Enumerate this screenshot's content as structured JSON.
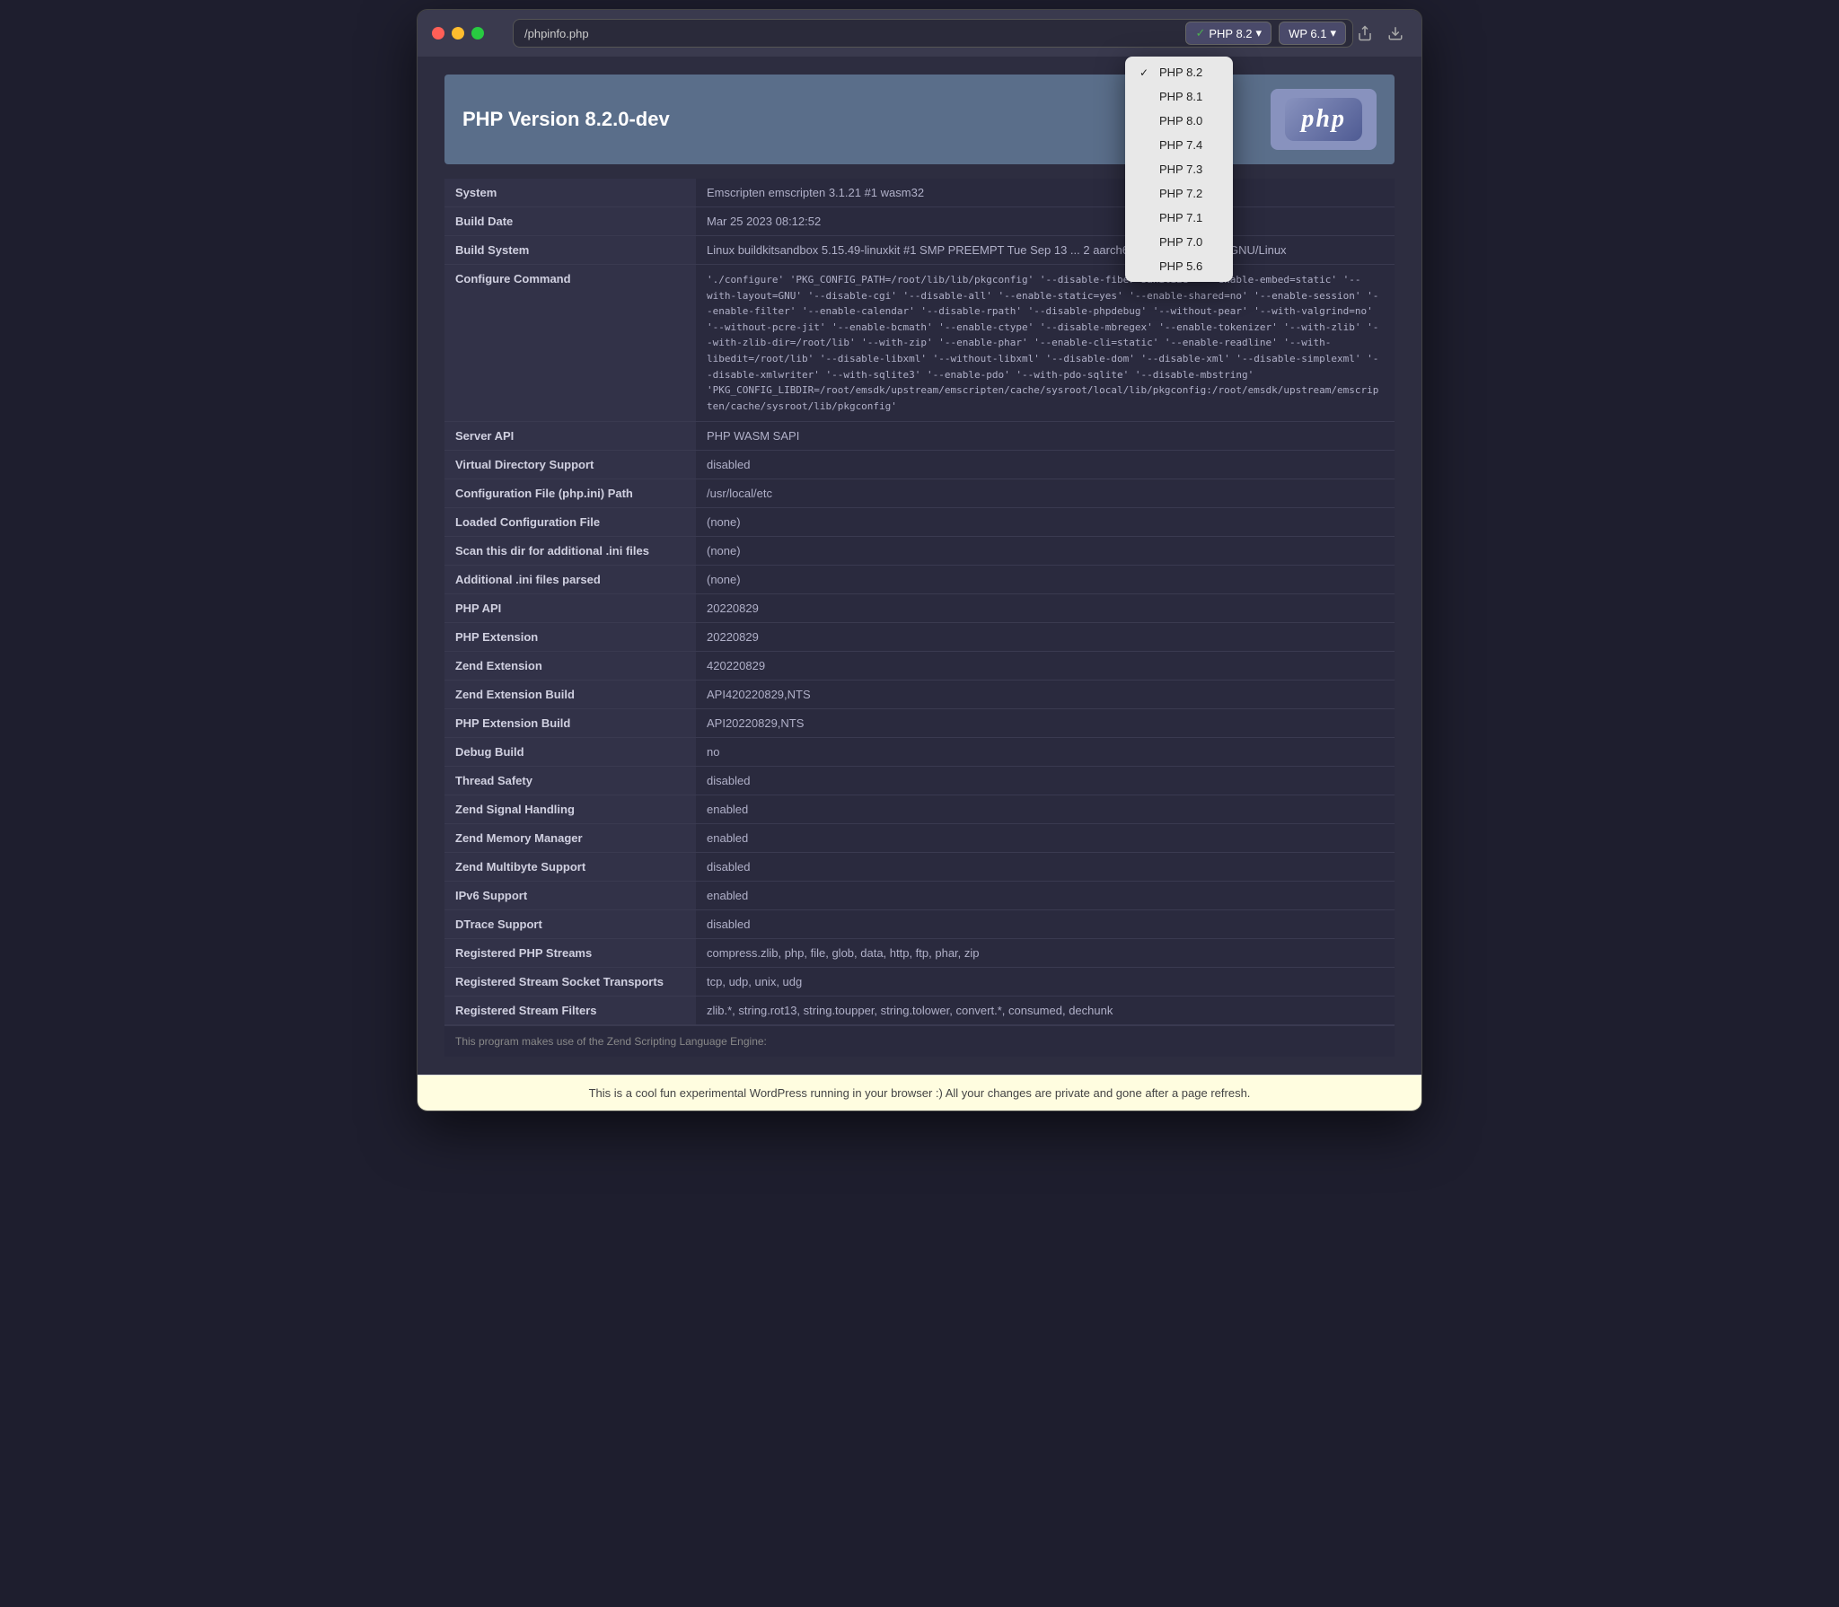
{
  "window": {
    "url": "/phpinfo.php"
  },
  "titlebar": {
    "traffic_lights": [
      "red",
      "yellow",
      "green"
    ],
    "php_version_selected": "PHP 8.2",
    "php_versions": [
      {
        "label": "PHP 8.2",
        "selected": true
      },
      {
        "label": "PHP 8.1",
        "selected": false
      },
      {
        "label": "PHP 8.0",
        "selected": false
      },
      {
        "label": "PHP 7.4",
        "selected": false
      },
      {
        "label": "PHP 7.3",
        "selected": false
      },
      {
        "label": "PHP 7.2",
        "selected": false
      },
      {
        "label": "PHP 7.1",
        "selected": false
      },
      {
        "label": "PHP 7.0",
        "selected": false
      },
      {
        "label": "PHP 5.6",
        "selected": false
      }
    ],
    "wp_version": "WP 6.1",
    "share_icon": "⬆",
    "download_icon": "⬇"
  },
  "php_info": {
    "title": "PHP Version 8.2.0-dev",
    "logo_text": "php",
    "rows": [
      {
        "label": "System",
        "value": "Emscripten emscripten 3.1.21 #1 wasm32"
      },
      {
        "label": "Build Date",
        "value": "Mar 25 2023 08:12:52"
      },
      {
        "label": "Build System",
        "value": "Linux buildkitsandbox 5.15.49-linuxkit #1 SMP PREEMPT Tue Sep 13 ... 2 aarch64 aarch64 aarch64 GNU/Linux"
      },
      {
        "label": "Configure Command",
        "value": "'./configure' 'PKG_CONFIG_PATH=/root/lib/lib/pkgconfig' '--disable-fiber-sanitize' '--enable-embed=static' '--with-layout=GNU' '--disable-cgi' '--disable-all' '--enable-static=yes' '--enable-shared=no' '--enable-session' '--enable-filter' '--enable-calendar' '--disable-rpath' '--disable-phpdebug' '--without-pear' '--with-valgrind=no' '--without-pcre-jit' '--enable-bcmath' '--enable-ctype' '--disable-mbregex' '--enable-tokenizer' '--with-zlib' '--with-zlib-dir=/root/lib' '--with-zip' '--enable-phar' '--enable-cli=static' '--enable-readline' '--with-libedit=/root/lib' '--disable-libxml' '--without-libxml' '--disable-dom' '--disable-xml' '--disable-simplexml' '--disable-xmlwriter' '--with-sqlite3' '--enable-pdo' '--with-pdo-sqlite' '--disable-mbstring'\n'PKG_CONFIG_LIBDIR=/root/emsdk/upstream/emscripten/cache/sysroot/local/lib/pkgconfig:/root/emsdk/upstream/emscripten/cache/sysroot/lib/pkgconfig'"
      },
      {
        "label": "Server API",
        "value": "PHP WASM SAPI"
      },
      {
        "label": "Virtual Directory Support",
        "value": "disabled"
      },
      {
        "label": "Configuration File (php.ini) Path",
        "value": "/usr/local/etc"
      },
      {
        "label": "Loaded Configuration File",
        "value": "(none)"
      },
      {
        "label": "Scan this dir for additional .ini files",
        "value": "(none)"
      },
      {
        "label": "Additional .ini files parsed",
        "value": "(none)"
      },
      {
        "label": "PHP API",
        "value": "20220829"
      },
      {
        "label": "PHP Extension",
        "value": "20220829"
      },
      {
        "label": "Zend Extension",
        "value": "420220829"
      },
      {
        "label": "Zend Extension Build",
        "value": "API420220829,NTS"
      },
      {
        "label": "PHP Extension Build",
        "value": "API20220829,NTS"
      },
      {
        "label": "Debug Build",
        "value": "no"
      },
      {
        "label": "Thread Safety",
        "value": "disabled"
      },
      {
        "label": "Zend Signal Handling",
        "value": "enabled"
      },
      {
        "label": "Zend Memory Manager",
        "value": "enabled"
      },
      {
        "label": "Zend Multibyte Support",
        "value": "disabled"
      },
      {
        "label": "IPv6 Support",
        "value": "enabled"
      },
      {
        "label": "DTrace Support",
        "value": "disabled"
      },
      {
        "label": "Registered PHP Streams",
        "value": "compress.zlib, php, file, glob, data, http, ftp, phar, zip"
      },
      {
        "label": "Registered Stream Socket Transports",
        "value": "tcp, udp, unix, udg"
      },
      {
        "label": "Registered Stream Filters",
        "value": "zlib.*, string.rot13, string.toupper, string.tolower, convert.*, consumed, dechunk"
      }
    ],
    "footer_text": "This program makes use of the Zend Scripting Language Engine:"
  },
  "bottom_bar": {
    "text": "This is a cool fun experimental WordPress running in your browser :) All your changes are private and gone after a page refresh."
  }
}
